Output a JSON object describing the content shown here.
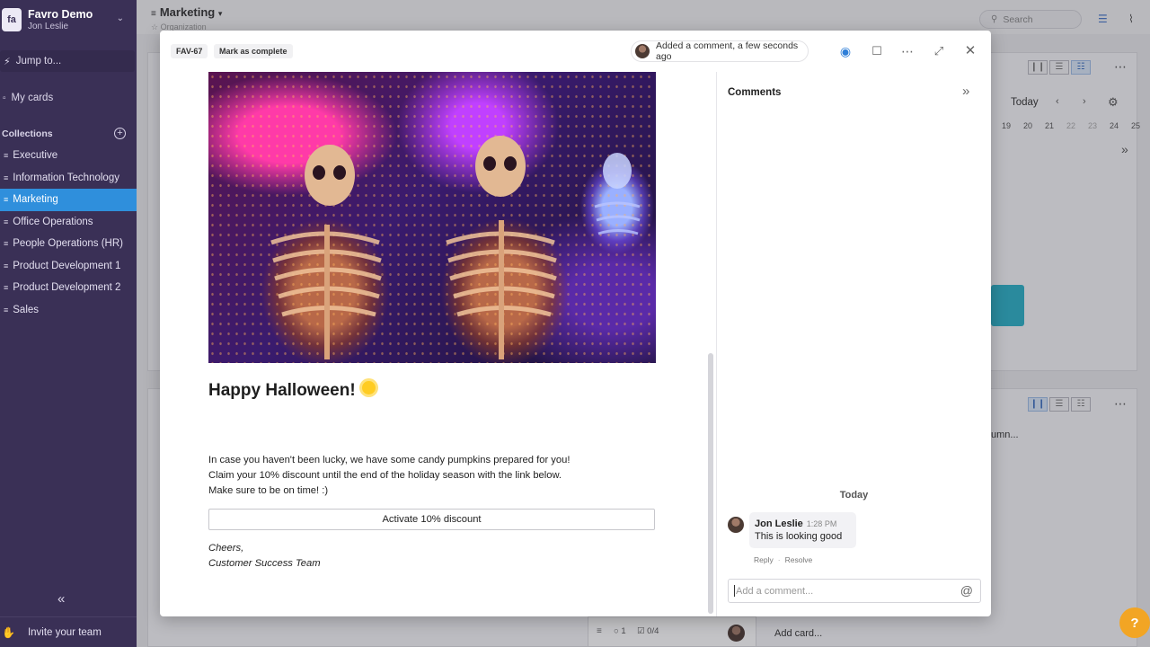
{
  "workspace": {
    "name": "Favro Demo",
    "user": "Jon Leslie",
    "logo": "fa"
  },
  "sidebar": {
    "jump_label": "Jump to...",
    "my_cards_label": "My cards",
    "collections_label": "Collections",
    "collections": [
      {
        "label": "Executive",
        "active": false
      },
      {
        "label": "Information Technology",
        "active": false
      },
      {
        "label": "Marketing",
        "active": true
      },
      {
        "label": "Office Operations",
        "active": false
      },
      {
        "label": "People Operations (HR)",
        "active": false
      },
      {
        "label": "Product Development 1",
        "active": false
      },
      {
        "label": "Product Development 2",
        "active": false
      },
      {
        "label": "Sales",
        "active": false
      }
    ],
    "invite_label": "Invite your team"
  },
  "board": {
    "title": "Marketing",
    "subtitle": "Organization",
    "search_placeholder": "Search",
    "today_label": "Today",
    "dates": [
      "19",
      "20",
      "21",
      "22",
      "23",
      "24",
      "25"
    ],
    "column_text": "umn...",
    "card_comments": "1",
    "card_tasks": "0/4",
    "add_card_label": "Add card..."
  },
  "modal": {
    "card_id": "FAV-67",
    "mark_complete_label": "Mark as complete",
    "activity_text": "Added a comment, a few seconds ago",
    "content": {
      "heading": "Happy Halloween!",
      "lines": [
        "In case you haven't been lucky, we have some candy pumpkins prepared for you!",
        "Claim your 10% discount until the end of the holiday season with the link below.",
        "Make sure to be on time! :)"
      ],
      "button_label": "Activate 10% discount",
      "signoff": [
        "Cheers,",
        "Customer Success Team"
      ]
    },
    "comments": {
      "title": "Comments",
      "day_label": "Today",
      "items": [
        {
          "author": "Jon Leslie",
          "time": "1:28 PM",
          "text": "This is looking good",
          "reply_label": "Reply",
          "resolve_label": "Resolve"
        }
      ],
      "input_placeholder": "Add a comment..."
    }
  },
  "colors": {
    "sidebar_bg": "#3a3056",
    "active_item": "#2f8fdc",
    "accent": "#2f7fd8",
    "help_button": "#f2a524"
  }
}
